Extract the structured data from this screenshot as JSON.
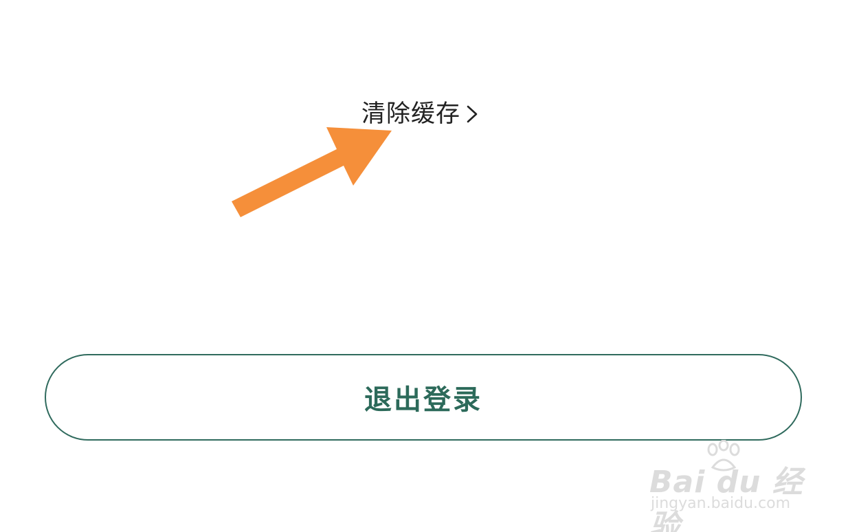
{
  "settings": {
    "clear_cache_label": "清除缓存",
    "chevron_icon": "chevron-right-icon"
  },
  "logout": {
    "label": "退出登录"
  },
  "annotation": {
    "arrow_color": "#f58f3a"
  },
  "watermark": {
    "brand": "Bai du 经验",
    "url": "jingyan.baidu.com"
  },
  "colors": {
    "accent": "#2c6a5a",
    "text": "#222222"
  }
}
